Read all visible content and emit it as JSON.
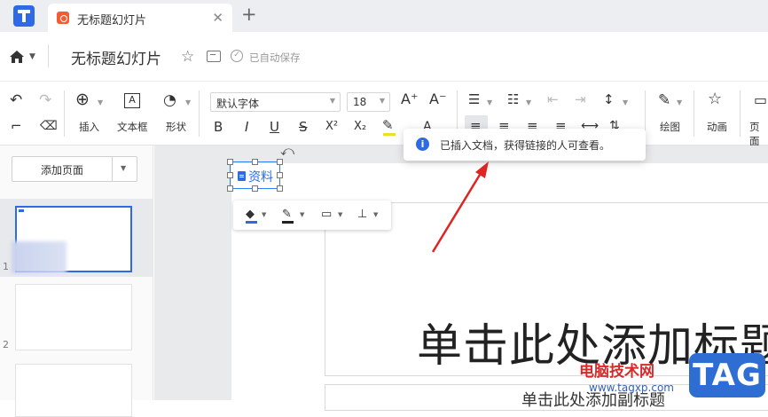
{
  "tabbar": {
    "doc_tab_title": "无标题幻灯片",
    "close_glyph": "✕",
    "new_tab_glyph": "+"
  },
  "titlebar": {
    "doc_title": "无标题幻灯片",
    "save_status": "已自动保存"
  },
  "ribbon": {
    "insert_label": "插入",
    "textbox_label": "文本框",
    "shape_label": "形状",
    "font_name": "默认字体",
    "font_size": "18",
    "draw_label": "绘图",
    "animation_label": "动画",
    "page_label": "页面",
    "bold": "B",
    "italic": "I",
    "underline": "U",
    "strike": "S",
    "superscript": "X²",
    "subscript": "X₂",
    "grow_font": "A⁺",
    "shrink_font": "A⁻"
  },
  "sidebar": {
    "add_page_label": "添加页面",
    "thumbnails": [
      {
        "number": "1",
        "selected": true
      },
      {
        "number": "2",
        "selected": false
      }
    ]
  },
  "slide": {
    "attachment_label": "资料",
    "title_placeholder": "单击此处添加标题",
    "subtitle_placeholder": "单击此处添加副标题"
  },
  "toast": {
    "message": "已插入文档，获得链接的人可查看。",
    "icon": "info-icon"
  },
  "watermark": {
    "site_name": "电脑技术网",
    "url": "www.tagxp.com",
    "logo": "TAG"
  },
  "colors": {
    "accent": "#2f6ae6",
    "selection_border": "#2f7df6",
    "arrow": "#e02424",
    "tab_icon": "#f25d34"
  }
}
